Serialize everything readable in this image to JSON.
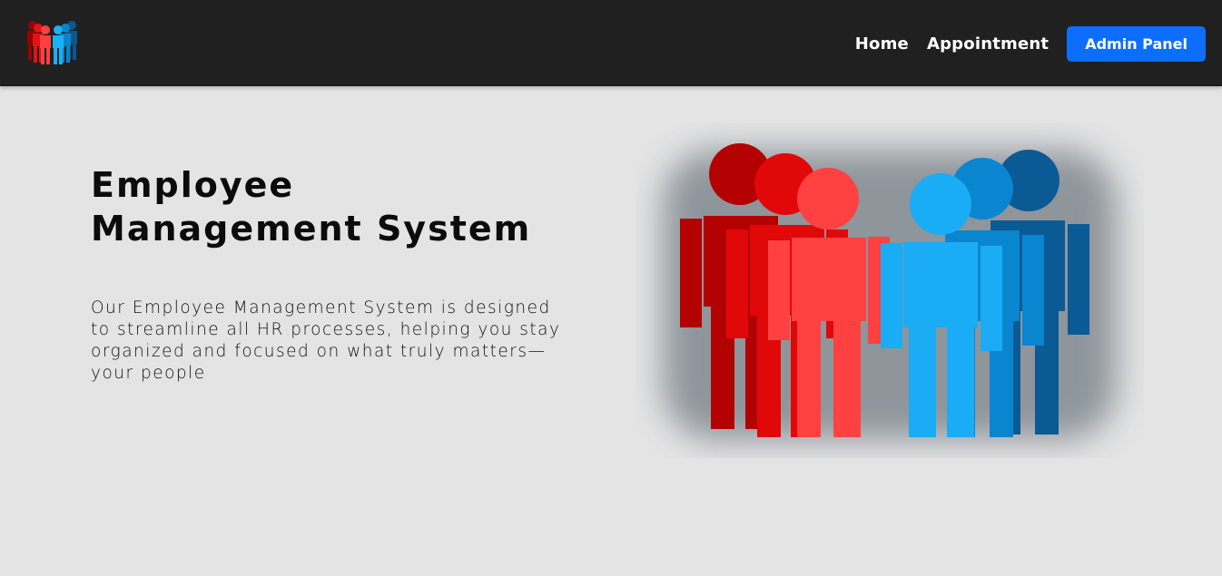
{
  "navbar": {
    "logo_icon": "people-group-icon",
    "links": [
      {
        "label": "Home"
      },
      {
        "label": "Appointment"
      }
    ],
    "admin_button": "Admin Panel",
    "colors": {
      "background": "#202020",
      "accent": "#0d6efd"
    }
  },
  "hero": {
    "title_line1": "Employee",
    "title_line2": "Management System",
    "description": "Our Employee Management System is designed to streamline all HR processes, helping you stay organized and focused on what truly matters—your people",
    "image_icon": "team-people-illustration",
    "colors": {
      "red": "#e01b1b",
      "blue": "#1aa3ea"
    }
  }
}
